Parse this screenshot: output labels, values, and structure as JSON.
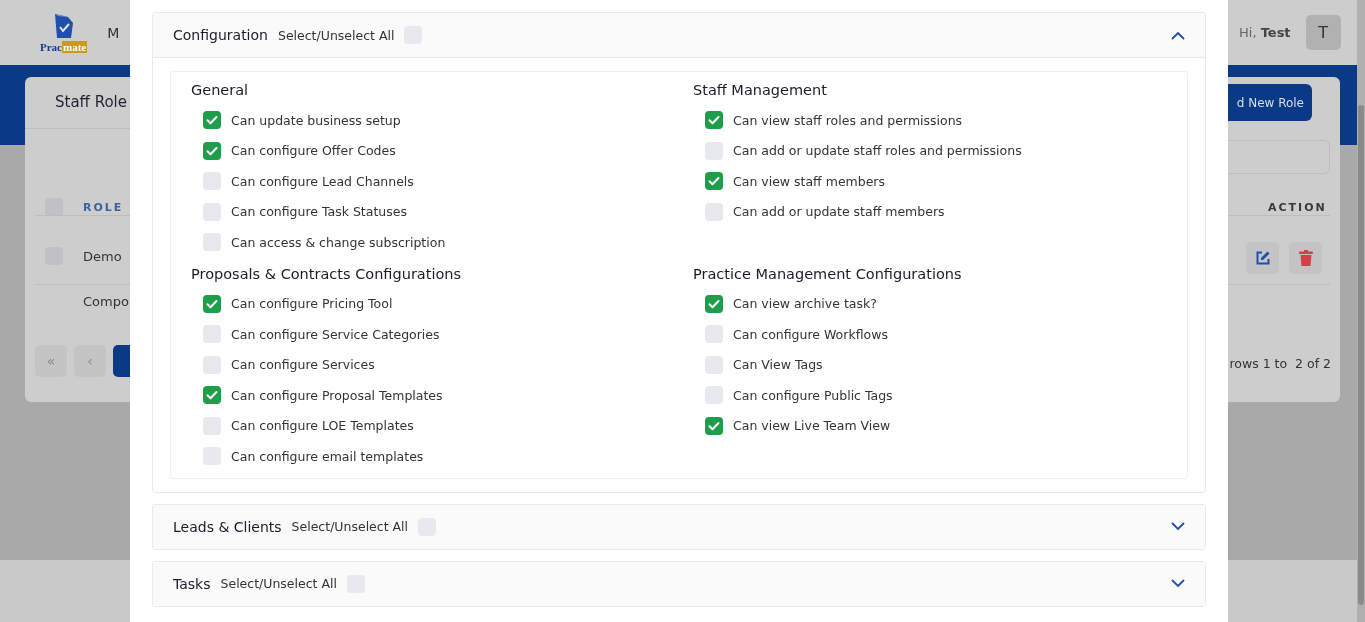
{
  "background": {
    "header": {
      "logo": {
        "part_1": "Prac",
        "part_2": "mate"
      },
      "nav_item": "M",
      "greeting": "Hi,",
      "user": "Test",
      "avatar": "T"
    },
    "card": {
      "title": "Staff Role",
      "add_button": "d New Role",
      "header_checked": false,
      "columns": [
        {
          "label": "ROLE"
        },
        {
          "label": "ACTION"
        }
      ],
      "rows": [
        {
          "role": "Demo",
          "checked": false
        },
        {
          "role": "Compo"
        }
      ],
      "pagination": {
        "first": "«",
        "prev": "‹"
      },
      "summary": "rows 1 to  2 of 2"
    }
  },
  "modal": {
    "sections": [
      {
        "title": "Configuration",
        "select_all_label": "Select/Unselect All",
        "all_checked": false,
        "expanded": true,
        "groups": [
          {
            "title": "General",
            "items": [
              {
                "label": "Can update business setup",
                "checked": true
              },
              {
                "label": "Can configure Offer Codes",
                "checked": true
              },
              {
                "label": "Can configure Lead Channels",
                "checked": false
              },
              {
                "label": "Can configure Task Statuses",
                "checked": false
              },
              {
                "label": "Can access & change subscription",
                "checked": false
              }
            ]
          },
          {
            "title": "Staff Management",
            "items": [
              {
                "label": "Can view staff roles and permissions",
                "checked": true
              },
              {
                "label": "Can add or update staff roles and permissions",
                "checked": false
              },
              {
                "label": "Can view staff members",
                "checked": true
              },
              {
                "label": "Can add or update staff members",
                "checked": false
              }
            ]
          },
          {
            "title": "Proposals & Contracts Configurations",
            "items": [
              {
                "label": "Can configure Pricing Tool",
                "checked": true
              },
              {
                "label": "Can configure Service Categories",
                "checked": false
              },
              {
                "label": "Can configure Services",
                "checked": false
              },
              {
                "label": "Can configure Proposal Templates",
                "checked": true
              },
              {
                "label": "Can configure LOE Templates",
                "checked": false
              },
              {
                "label": "Can configure email templates",
                "checked": false
              }
            ]
          },
          {
            "title": "Practice Management Configurations",
            "items": [
              {
                "label": "Can view archive task?",
                "checked": true
              },
              {
                "label": "Can configure Workflows",
                "checked": false
              },
              {
                "label": "Can View Tags",
                "checked": false
              },
              {
                "label": "Can configure Public Tags",
                "checked": false
              },
              {
                "label": "Can view Live Team View",
                "checked": true
              }
            ]
          }
        ]
      },
      {
        "title": "Leads & Clients",
        "select_all_label": "Select/Unselect All",
        "all_checked": false,
        "expanded": false
      },
      {
        "title": "Tasks",
        "select_all_label": "Select/Unselect All",
        "all_checked": false,
        "expanded": false
      }
    ]
  }
}
